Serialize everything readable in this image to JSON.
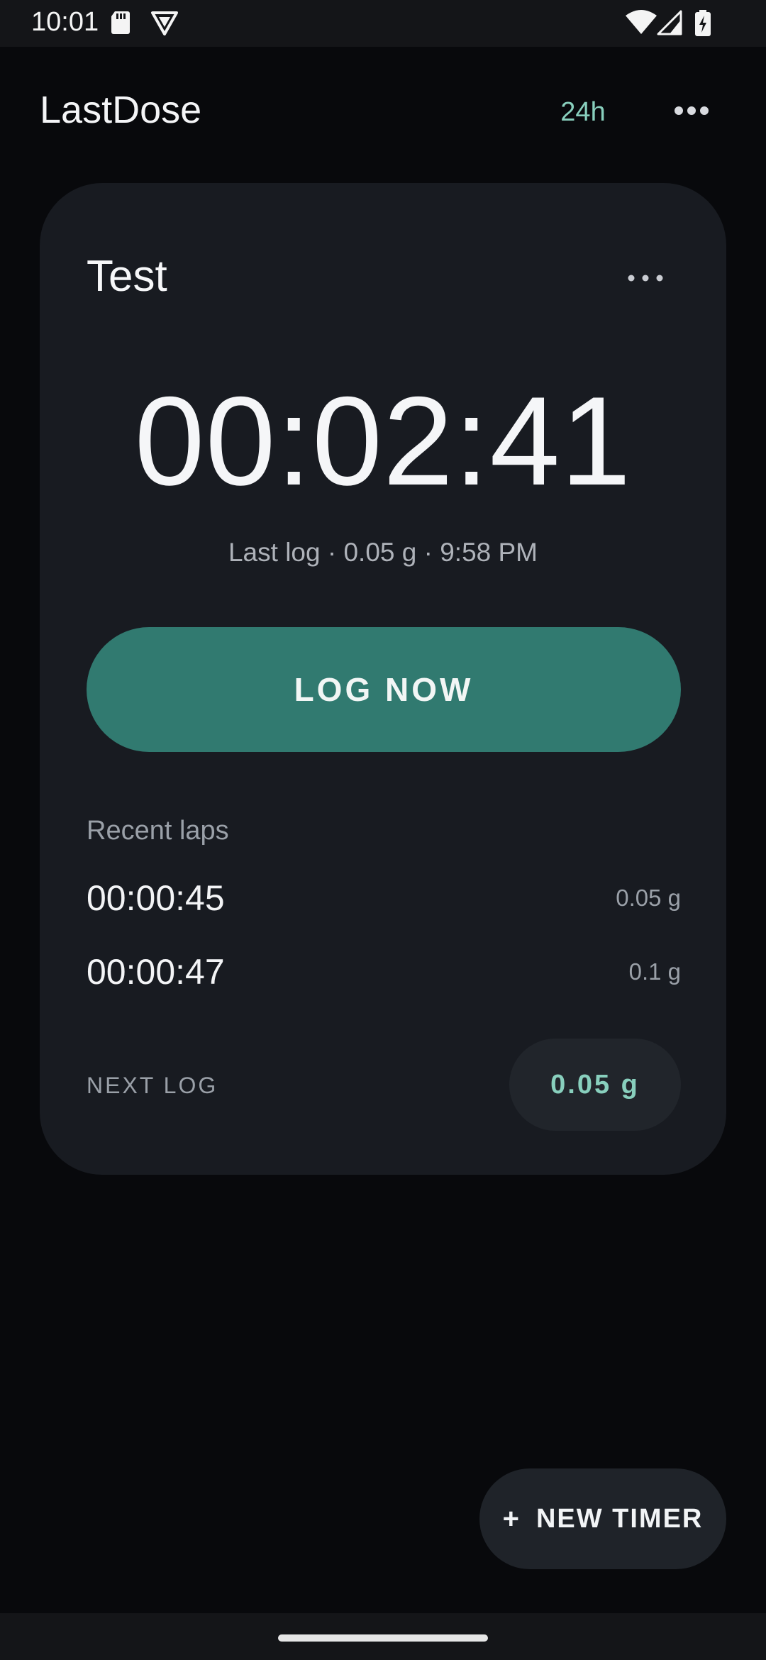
{
  "status_bar": {
    "time": "10:01",
    "icons": [
      "sd-card-icon",
      "vpn-shield-icon",
      "wifi-icon",
      "cellular-signal-icon",
      "battery-charging-icon"
    ]
  },
  "app_bar": {
    "title": "LastDose",
    "range_label": "24h",
    "overflow_icon": "more-horizontal-icon"
  },
  "timer_card": {
    "title": "Test",
    "menu_icon": "more-horizontal-icon",
    "elapsed": "00:02:41",
    "last_log": "Last log · 0.05 g  ·  9:58 PM",
    "log_button_label": "LOG NOW",
    "recent_heading": "Recent laps",
    "laps": [
      {
        "time": "00:00:45",
        "amount": "0.05 g"
      },
      {
        "time": "00:00:47",
        "amount": "0.1 g"
      }
    ],
    "next_log_label": "NEXT LOG",
    "next_log_amount": "0.05 g"
  },
  "fab": {
    "icon": "plus-icon",
    "label": "NEW TIMER"
  },
  "colors": {
    "background": "#08090c",
    "card": "#181b21",
    "accent": "#317a70",
    "accent_text": "#88cfbd"
  }
}
